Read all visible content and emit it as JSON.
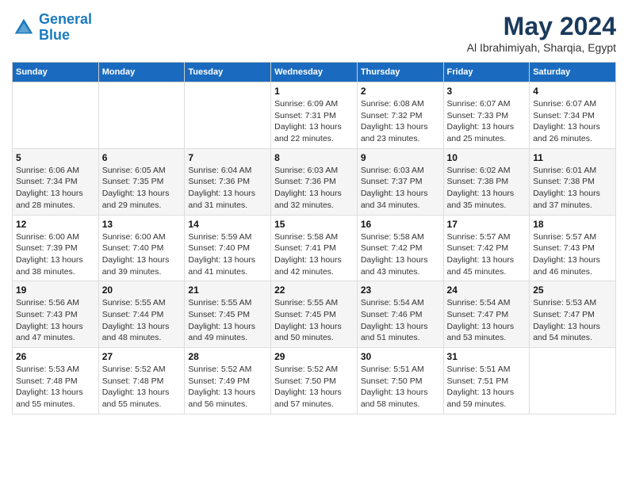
{
  "header": {
    "logo_line1": "General",
    "logo_line2": "Blue",
    "title": "May 2024",
    "subtitle": "Al Ibrahimiyah, Sharqia, Egypt"
  },
  "columns": [
    "Sunday",
    "Monday",
    "Tuesday",
    "Wednesday",
    "Thursday",
    "Friday",
    "Saturday"
  ],
  "weeks": [
    [
      {
        "day": "",
        "info": ""
      },
      {
        "day": "",
        "info": ""
      },
      {
        "day": "",
        "info": ""
      },
      {
        "day": "1",
        "info": "Sunrise: 6:09 AM\nSunset: 7:31 PM\nDaylight: 13 hours\nand 22 minutes."
      },
      {
        "day": "2",
        "info": "Sunrise: 6:08 AM\nSunset: 7:32 PM\nDaylight: 13 hours\nand 23 minutes."
      },
      {
        "day": "3",
        "info": "Sunrise: 6:07 AM\nSunset: 7:33 PM\nDaylight: 13 hours\nand 25 minutes."
      },
      {
        "day": "4",
        "info": "Sunrise: 6:07 AM\nSunset: 7:34 PM\nDaylight: 13 hours\nand 26 minutes."
      }
    ],
    [
      {
        "day": "5",
        "info": "Sunrise: 6:06 AM\nSunset: 7:34 PM\nDaylight: 13 hours\nand 28 minutes."
      },
      {
        "day": "6",
        "info": "Sunrise: 6:05 AM\nSunset: 7:35 PM\nDaylight: 13 hours\nand 29 minutes."
      },
      {
        "day": "7",
        "info": "Sunrise: 6:04 AM\nSunset: 7:36 PM\nDaylight: 13 hours\nand 31 minutes."
      },
      {
        "day": "8",
        "info": "Sunrise: 6:03 AM\nSunset: 7:36 PM\nDaylight: 13 hours\nand 32 minutes."
      },
      {
        "day": "9",
        "info": "Sunrise: 6:03 AM\nSunset: 7:37 PM\nDaylight: 13 hours\nand 34 minutes."
      },
      {
        "day": "10",
        "info": "Sunrise: 6:02 AM\nSunset: 7:38 PM\nDaylight: 13 hours\nand 35 minutes."
      },
      {
        "day": "11",
        "info": "Sunrise: 6:01 AM\nSunset: 7:38 PM\nDaylight: 13 hours\nand 37 minutes."
      }
    ],
    [
      {
        "day": "12",
        "info": "Sunrise: 6:00 AM\nSunset: 7:39 PM\nDaylight: 13 hours\nand 38 minutes."
      },
      {
        "day": "13",
        "info": "Sunrise: 6:00 AM\nSunset: 7:40 PM\nDaylight: 13 hours\nand 39 minutes."
      },
      {
        "day": "14",
        "info": "Sunrise: 5:59 AM\nSunset: 7:40 PM\nDaylight: 13 hours\nand 41 minutes."
      },
      {
        "day": "15",
        "info": "Sunrise: 5:58 AM\nSunset: 7:41 PM\nDaylight: 13 hours\nand 42 minutes."
      },
      {
        "day": "16",
        "info": "Sunrise: 5:58 AM\nSunset: 7:42 PM\nDaylight: 13 hours\nand 43 minutes."
      },
      {
        "day": "17",
        "info": "Sunrise: 5:57 AM\nSunset: 7:42 PM\nDaylight: 13 hours\nand 45 minutes."
      },
      {
        "day": "18",
        "info": "Sunrise: 5:57 AM\nSunset: 7:43 PM\nDaylight: 13 hours\nand 46 minutes."
      }
    ],
    [
      {
        "day": "19",
        "info": "Sunrise: 5:56 AM\nSunset: 7:43 PM\nDaylight: 13 hours\nand 47 minutes."
      },
      {
        "day": "20",
        "info": "Sunrise: 5:55 AM\nSunset: 7:44 PM\nDaylight: 13 hours\nand 48 minutes."
      },
      {
        "day": "21",
        "info": "Sunrise: 5:55 AM\nSunset: 7:45 PM\nDaylight: 13 hours\nand 49 minutes."
      },
      {
        "day": "22",
        "info": "Sunrise: 5:55 AM\nSunset: 7:45 PM\nDaylight: 13 hours\nand 50 minutes."
      },
      {
        "day": "23",
        "info": "Sunrise: 5:54 AM\nSunset: 7:46 PM\nDaylight: 13 hours\nand 51 minutes."
      },
      {
        "day": "24",
        "info": "Sunrise: 5:54 AM\nSunset: 7:47 PM\nDaylight: 13 hours\nand 53 minutes."
      },
      {
        "day": "25",
        "info": "Sunrise: 5:53 AM\nSunset: 7:47 PM\nDaylight: 13 hours\nand 54 minutes."
      }
    ],
    [
      {
        "day": "26",
        "info": "Sunrise: 5:53 AM\nSunset: 7:48 PM\nDaylight: 13 hours\nand 55 minutes."
      },
      {
        "day": "27",
        "info": "Sunrise: 5:52 AM\nSunset: 7:48 PM\nDaylight: 13 hours\nand 55 minutes."
      },
      {
        "day": "28",
        "info": "Sunrise: 5:52 AM\nSunset: 7:49 PM\nDaylight: 13 hours\nand 56 minutes."
      },
      {
        "day": "29",
        "info": "Sunrise: 5:52 AM\nSunset: 7:50 PM\nDaylight: 13 hours\nand 57 minutes."
      },
      {
        "day": "30",
        "info": "Sunrise: 5:51 AM\nSunset: 7:50 PM\nDaylight: 13 hours\nand 58 minutes."
      },
      {
        "day": "31",
        "info": "Sunrise: 5:51 AM\nSunset: 7:51 PM\nDaylight: 13 hours\nand 59 minutes."
      },
      {
        "day": "",
        "info": ""
      }
    ]
  ]
}
